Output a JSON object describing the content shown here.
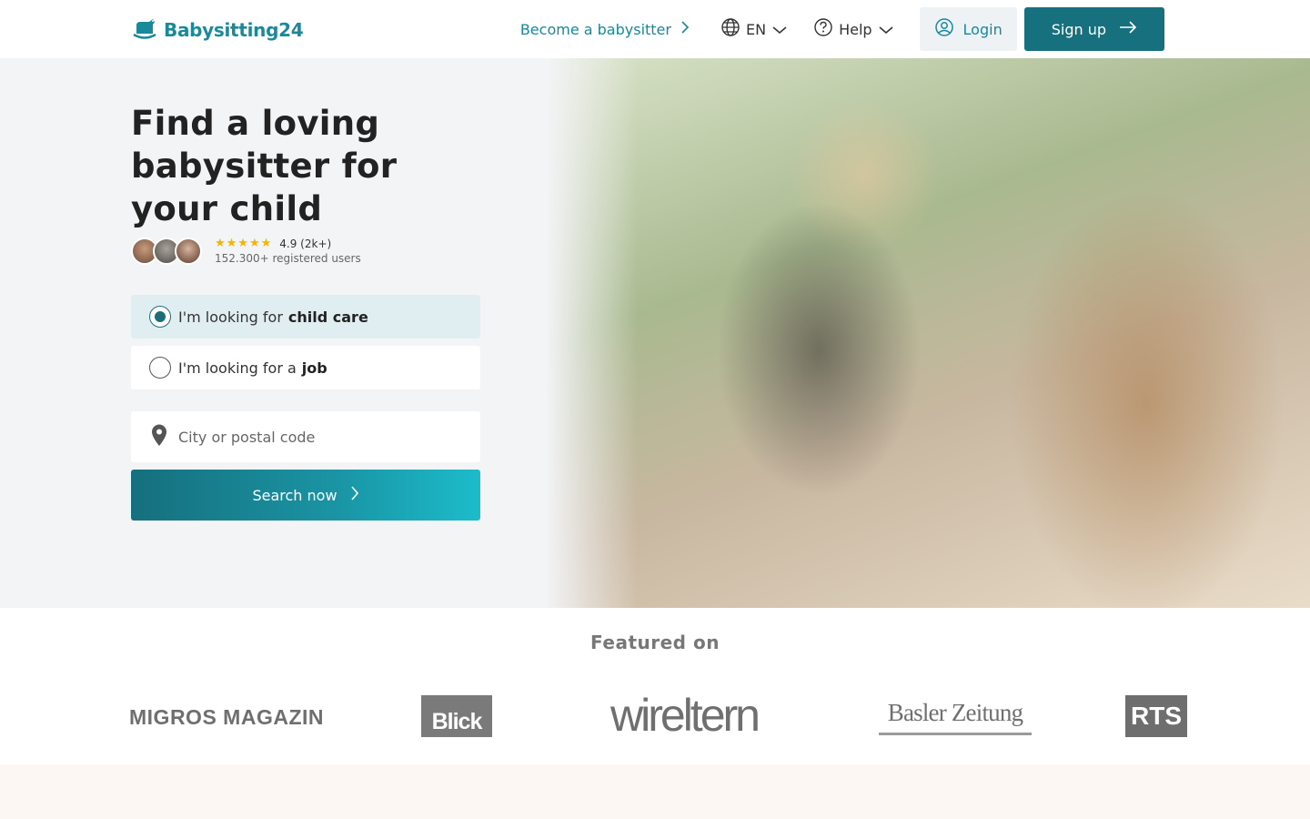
{
  "header": {
    "logo_text": "Babysitting24",
    "become_label": "Become a babysitter",
    "language_label": "EN",
    "help_label": "Help",
    "login_label": "Login",
    "signup_label": "Sign up"
  },
  "hero": {
    "title": "Find a loving babysitter for your child",
    "rating": "4.9 (2k+)",
    "users": "152.300+ registered users",
    "stars": "★★★★★",
    "options": [
      {
        "prefix": "I'm looking for",
        "emphasis": "child care",
        "selected": true
      },
      {
        "prefix": "I'm looking for a",
        "emphasis": "job",
        "selected": false
      }
    ],
    "location_placeholder": "City or postal code",
    "search_label": "Search now"
  },
  "featured": {
    "title": "Featured on",
    "logos": [
      "MIGROS MAGAZIN",
      "Blick",
      "wireltern",
      "Basler Zeitung",
      "RTS"
    ]
  },
  "colors": {
    "brand": "#16899a",
    "brand_dark": "#17707e",
    "star": "#f4b400"
  },
  "icons": [
    "rocking-horse-logo-icon",
    "chevron-right-icon",
    "globe-icon",
    "chevron-down-icon",
    "help-circle-icon",
    "user-circle-icon",
    "arrow-right-icon",
    "map-pin-icon"
  ]
}
